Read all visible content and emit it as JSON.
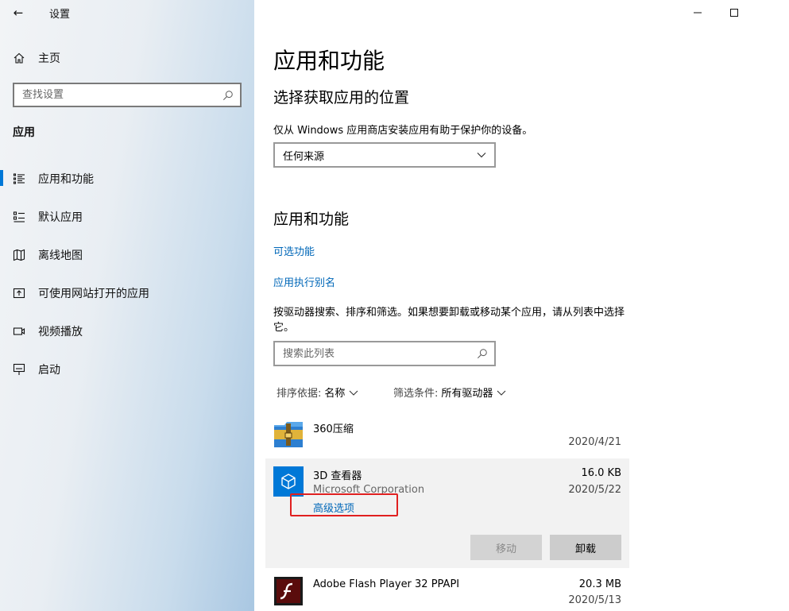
{
  "window": {
    "title": "设置",
    "back_glyph": "←",
    "minimize_glyph": "—",
    "maximize_glyph": "☐"
  },
  "sidebar": {
    "home_label": "主页",
    "search_placeholder": "查找设置",
    "section": "应用",
    "items": [
      {
        "label": "应用和功能",
        "icon": "apps-features-icon",
        "active": true
      },
      {
        "label": "默认应用",
        "icon": "default-apps-icon",
        "active": false
      },
      {
        "label": "离线地图",
        "icon": "offline-maps-icon",
        "active": false
      },
      {
        "label": "可使用网站打开的应用",
        "icon": "apps-for-websites-icon",
        "active": false
      },
      {
        "label": "视频播放",
        "icon": "video-playback-icon",
        "active": false
      },
      {
        "label": "启动",
        "icon": "startup-icon",
        "active": false
      }
    ]
  },
  "main": {
    "title": "应用和功能",
    "choose_heading": "选择获取应用的位置",
    "choose_desc": "仅从 Windows 应用商店安装应用有助于保护你的设备。",
    "source_value": "任何来源",
    "apps_heading": "应用和功能",
    "optional_features_link": "可选功能",
    "aliases_link": "应用执行别名",
    "list_desc": "按驱动器搜索、排序和筛选。如果想要卸载或移动某个应用，请从列表中选择它。",
    "list_search_placeholder": "搜索此列表",
    "sort_key": "排序依据:",
    "sort_value": "名称",
    "filter_key": "筛选条件:",
    "filter_value": "所有驱动器",
    "apps": [
      {
        "name": "360压缩",
        "publisher": "",
        "size": "",
        "date": "2020/4/21"
      },
      {
        "name": "3D 查看器",
        "publisher": "Microsoft Corporation",
        "size": "16.0 KB",
        "date": "2020/5/22"
      },
      {
        "name": "Adobe Flash Player 32 PPAPI",
        "publisher": "",
        "size": "20.3 MB",
        "date": "2020/5/13"
      }
    ],
    "advanced_options": "高级选项",
    "move_button": "移动",
    "uninstall_button": "卸载"
  },
  "colors": {
    "accent": "#0078d7",
    "link": "#0067b8",
    "highlight_box": "#e02020"
  }
}
